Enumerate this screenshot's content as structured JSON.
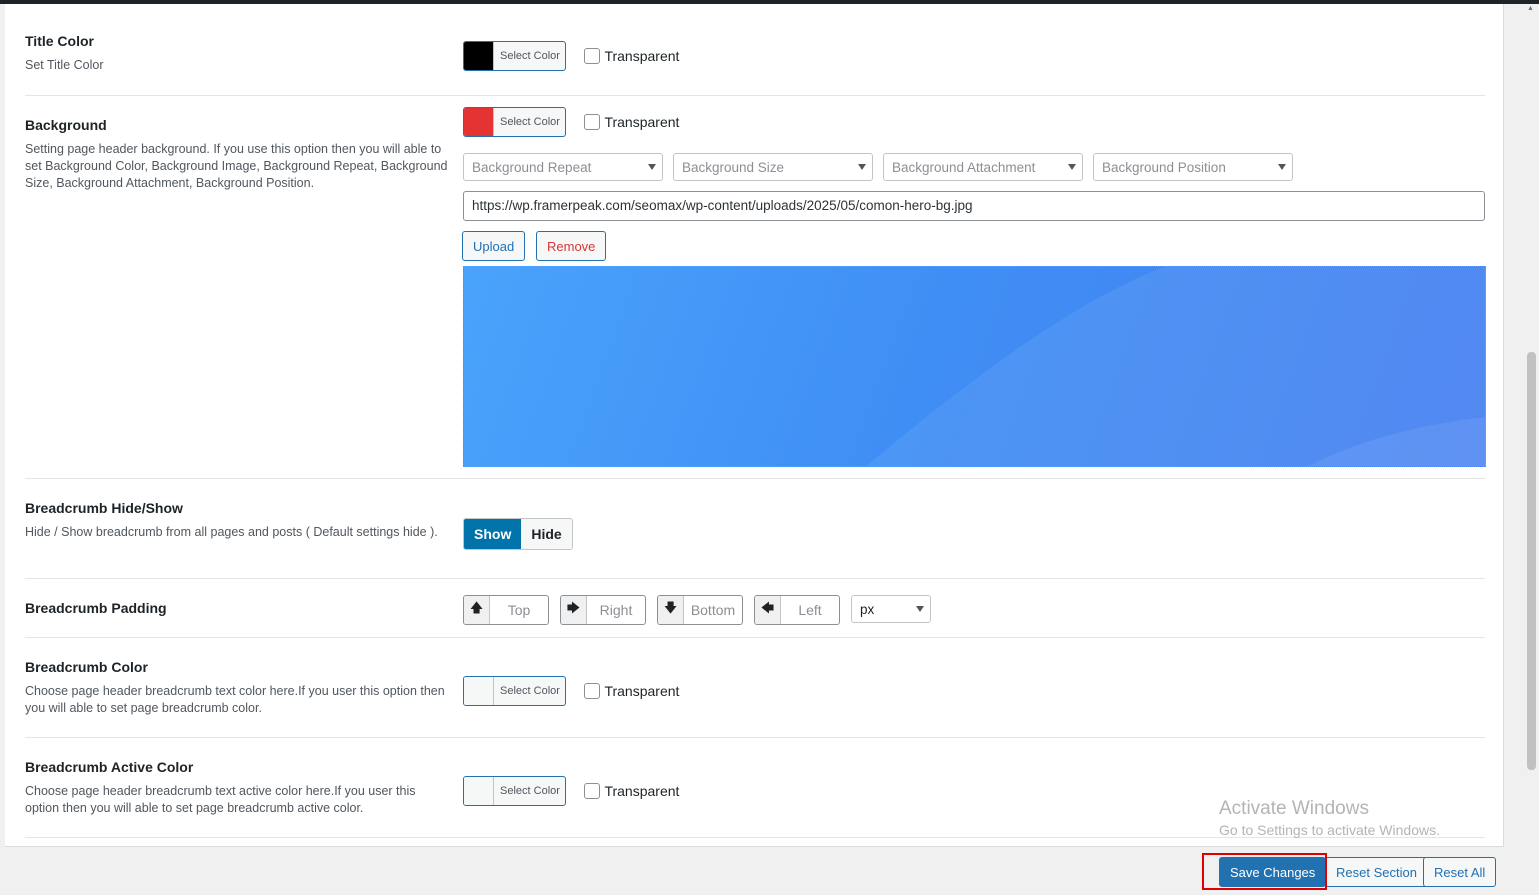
{
  "title_color": {
    "title": "Title Color",
    "desc": "Set Title Color",
    "select_label": "Select Color",
    "swatch": "#000000",
    "transparent_label": "Transparent"
  },
  "background": {
    "title": "Background",
    "desc": "Setting page header background. If you use this option then you will able to set Background Color, Background Image, Background Repeat, Background Size, Background Attachment, Background Position.",
    "select_label": "Select Color",
    "swatch": "#e53333",
    "transparent_label": "Transparent",
    "selects": [
      "Background Repeat",
      "Background Size",
      "Background Attachment",
      "Background Position"
    ],
    "url": "https://wp.framerpeak.com/seomax/wp-content/uploads/2025/05/comon-hero-bg.jpg",
    "upload_label": "Upload",
    "remove_label": "Remove"
  },
  "breadcrumb_toggle": {
    "title": "Breadcrumb Hide/Show",
    "desc": "Hide / Show breadcrumb from all pages and posts ( Default settings hide ).",
    "show_label": "Show",
    "hide_label": "Hide",
    "selected": "Show"
  },
  "breadcrumb_padding": {
    "title": "Breadcrumb Padding",
    "top": "Top",
    "right": "Right",
    "bottom": "Bottom",
    "left": "Left",
    "unit": "px"
  },
  "breadcrumb_color": {
    "title": "Breadcrumb Color",
    "desc": "Choose page header breadcrumb text color here.If you user this option then you will able to set page breadcrumb color.",
    "select_label": "Select Color",
    "transparent_label": "Transparent"
  },
  "breadcrumb_active_color": {
    "title": "Breadcrumb Active Color",
    "desc": "Choose page header breadcrumb text active color here.If you user this option then you will able to set page breadcrumb active color.",
    "select_label": "Select Color",
    "transparent_label": "Transparent"
  },
  "footer": {
    "save_label": "Save Changes",
    "reset_section_label": "Reset Section",
    "reset_all_label": "Reset All"
  },
  "watermark": {
    "line1": "Activate Windows",
    "line2": "Go to Settings to activate Windows."
  }
}
